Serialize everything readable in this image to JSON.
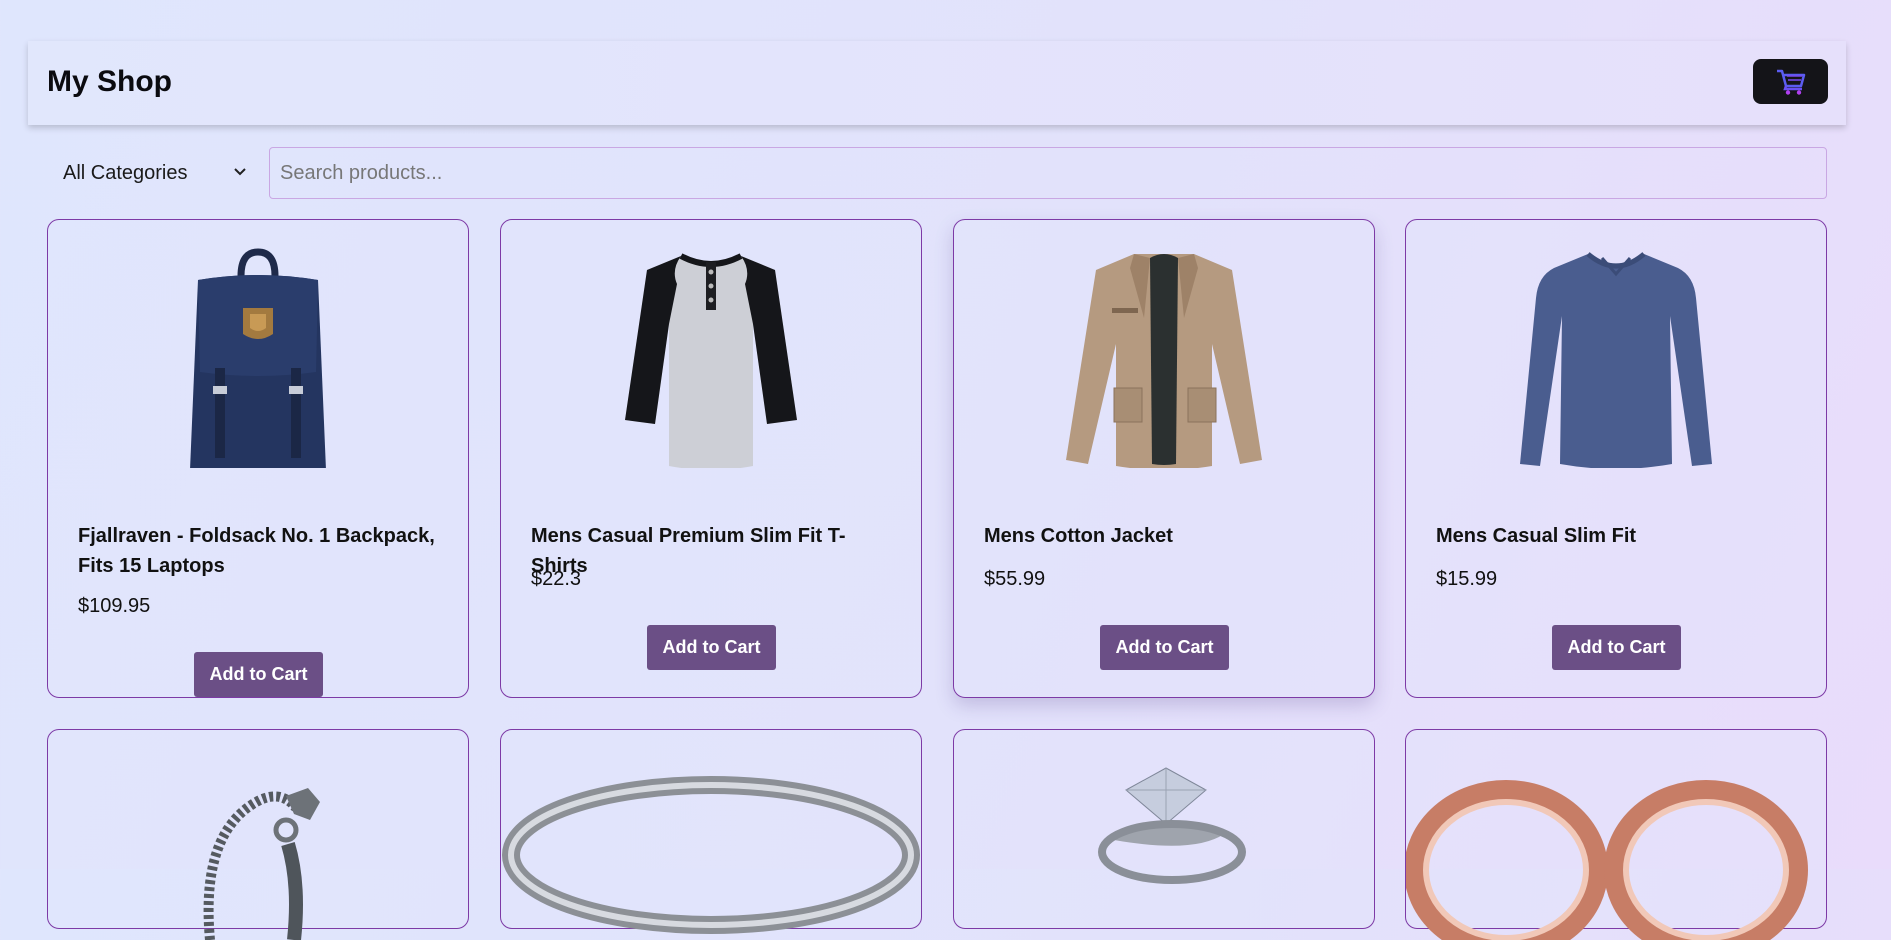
{
  "header": {
    "title": "My Shop",
    "cart_icon": "shopping-cart-icon"
  },
  "filters": {
    "category_selected": "All Categories",
    "search_placeholder": "Search products..."
  },
  "products": [
    {
      "name": "Fjallraven - Foldsack No. 1 Backpack, Fits 15 Laptops",
      "price": "$109.95",
      "button": "Add to Cart",
      "image": "backpack-image"
    },
    {
      "name": "Mens Casual Premium Slim Fit T-Shirts",
      "price": "$22.3",
      "button": "Add to Cart",
      "image": "raglan-tshirt-image"
    },
    {
      "name": "Mens Cotton Jacket",
      "price": "$55.99",
      "button": "Add to Cart",
      "image": "cotton-jacket-image"
    },
    {
      "name": "Mens Casual Slim Fit",
      "price": "$15.99",
      "button": "Add to Cart",
      "image": "longsleeve-shirt-image"
    }
  ],
  "products_row2": [
    {
      "image": "dragon-bracelet-image"
    },
    {
      "image": "silver-ring-image"
    },
    {
      "image": "diamond-ring-image"
    },
    {
      "image": "rose-gold-rings-image"
    }
  ],
  "colors": {
    "accent": "#6b4f86",
    "card_border": "#7d3aa6",
    "cart_button": "#141418"
  }
}
